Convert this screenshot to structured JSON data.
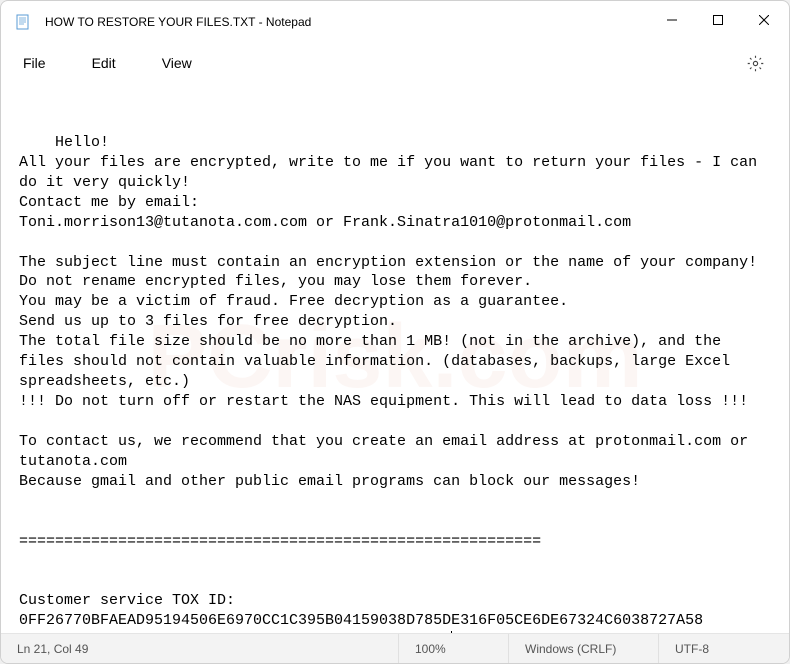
{
  "titlebar": {
    "title": "HOW TO RESTORE YOUR FILES.TXT - Notepad"
  },
  "menu": {
    "file": "File",
    "edit": "Edit",
    "view": "View"
  },
  "editor": {
    "content": "Hello!\nAll your files are encrypted, write to me if you want to return your files - I can do it very quickly!\nContact me by email:\nToni.morrison13@tutanota.com.com or Frank.Sinatra1010@protonmail.com\n\nThe subject line must contain an encryption extension or the name of your company!\nDo not rename encrypted files, you may lose them forever.\nYou may be a victim of fraud. Free decryption as a guarantee.\nSend us up to 3 files for free decryption.\nThe total file size should be no more than 1 MB! (not in the archive), and the files should not contain valuable information. (databases, backups, large Excel spreadsheets, etc.)\n!!! Do not turn off or restart the NAS equipment. This will lead to data loss !!!\n\nTo contact us, we recommend that you create an email address at protonmail.com or tutanota.com\nBecause gmail and other public email programs can block our messages!\n\n\n==========================================================\n\n\nCustomer service TOX ID: 0FF26770BFAEAD95194506E6970CC1C395B04159038D785DE316F05CE6DE67324C6038727A58\nOnly emergency! Use if support is not responding"
  },
  "statusbar": {
    "position": "Ln 21, Col 49",
    "zoom": "100%",
    "line_ending": "Windows (CRLF)",
    "encoding": "UTF-8"
  }
}
